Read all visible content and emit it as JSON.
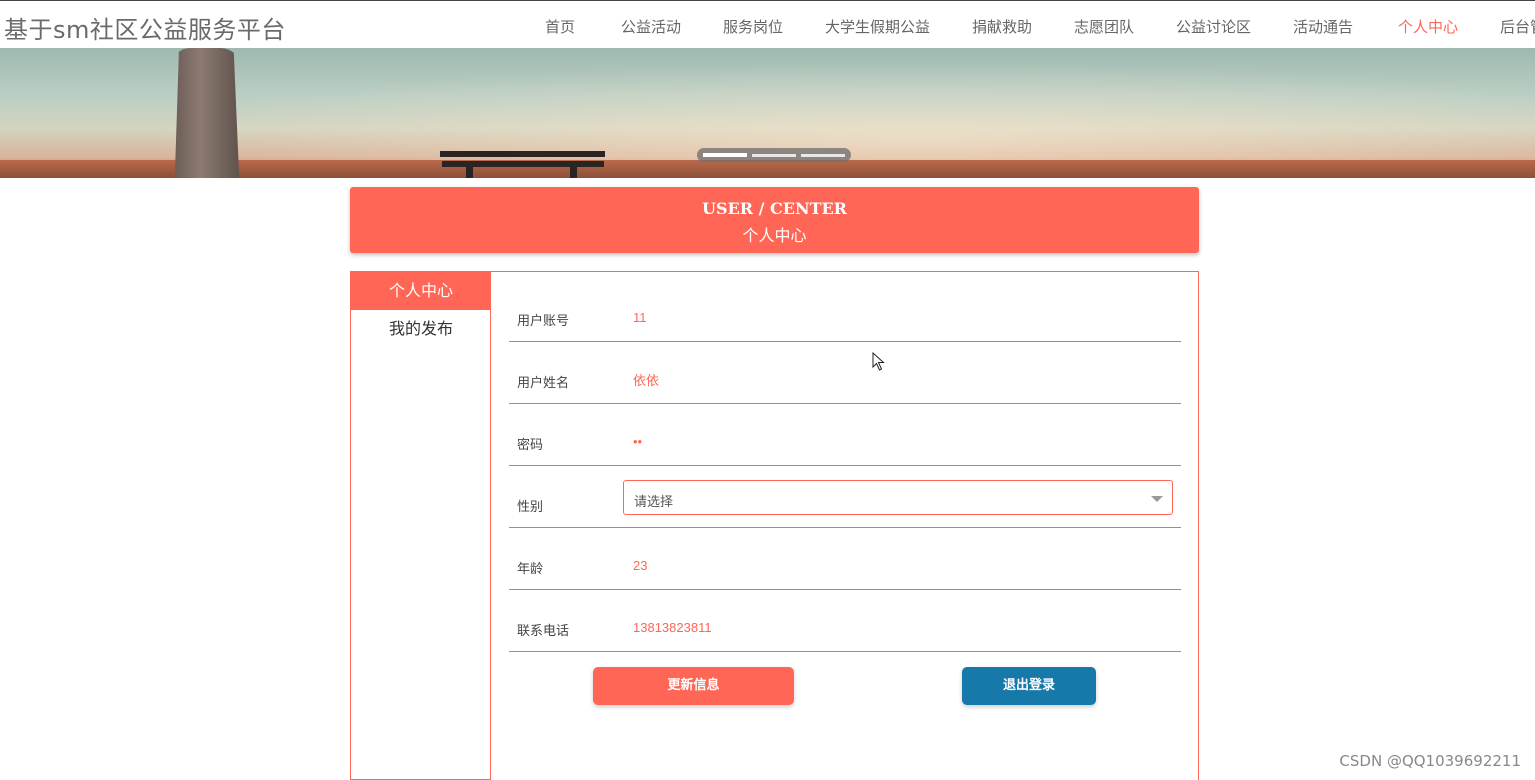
{
  "header": {
    "site_title": "基于sm社区公益服务平台",
    "nav": [
      {
        "label": "首页"
      },
      {
        "label": "公益活动"
      },
      {
        "label": "服务岗位"
      },
      {
        "label": "大学生假期公益"
      },
      {
        "label": "捐献救助"
      },
      {
        "label": "志愿团队"
      },
      {
        "label": "公益讨论区"
      },
      {
        "label": "活动通告"
      },
      {
        "label": "个人中心",
        "active": true
      },
      {
        "label": "后台管"
      }
    ],
    "active_color": "#ff6655"
  },
  "banner": {
    "slide_count": 3,
    "active_slide": 1
  },
  "section": {
    "title_en": "USER / CENTER",
    "title_cn": "个人中心"
  },
  "sidebar": {
    "items": [
      {
        "label": "个人中心",
        "active": true
      },
      {
        "label": "我的发布"
      }
    ]
  },
  "form": {
    "username": {
      "label": "用户账号",
      "value": "11"
    },
    "name": {
      "label": "用户姓名",
      "value": "依依"
    },
    "password": {
      "label": "密码",
      "value": "••"
    },
    "gender": {
      "label": "性别",
      "selected": "请选择"
    },
    "age": {
      "label": "年龄",
      "value": "23"
    },
    "phone": {
      "label": "联系电话",
      "value": "13813823811"
    },
    "update_button": "更新信息",
    "logout_button": "退出登录"
  },
  "colors": {
    "accent": "#ff6655",
    "logout": "#1679a9"
  },
  "watermark": "CSDN @QQ1039692211"
}
